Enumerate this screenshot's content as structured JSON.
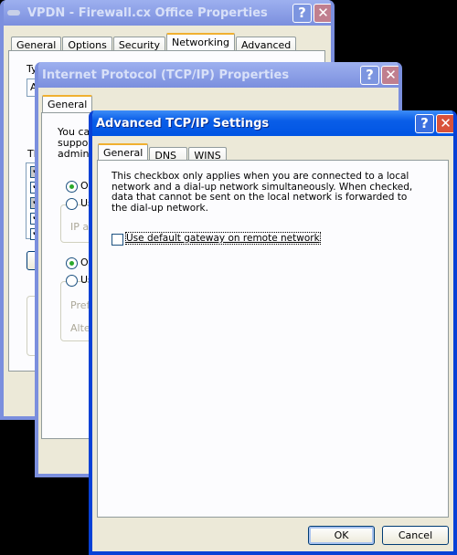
{
  "win1": {
    "title": "VPDN - Firewall.cx Office Properties",
    "tabs": [
      "General",
      "Options",
      "Security",
      "Networking",
      "Advanced"
    ],
    "selected_tab": "Networking",
    "frag_type": "Ty",
    "frag_combo": "Ar",
    "frag_this": "Th",
    "frag_d": "D"
  },
  "win2": {
    "title": "Internet Protocol (TCP/IP) Properties",
    "tabs": [
      "General"
    ],
    "frag_lines": [
      "You ca",
      "support",
      "adminis"
    ],
    "frag_ob1": "Ob",
    "frag_us1": "Us",
    "frag_ip": "IP ad",
    "frag_ob2": "Ob",
    "frag_us2": "Us",
    "frag_pref": "Prefe",
    "frag_alt": "Altern"
  },
  "win3": {
    "title": "Advanced TCP/IP Settings",
    "tabs": [
      "General",
      "DNS",
      "WINS"
    ],
    "selected_tab": "General",
    "description": "This checkbox only applies when you are connected to a local network and a dial-up network simultaneously.  When checked, data that cannot be sent on the local network is forwarded to the dial-up network.",
    "checkbox_label": "Use default gateway on remote network",
    "checkbox_checked": false,
    "ok": "OK",
    "cancel": "Cancel"
  },
  "buttons": {
    "help": "?",
    "close": "✕"
  }
}
